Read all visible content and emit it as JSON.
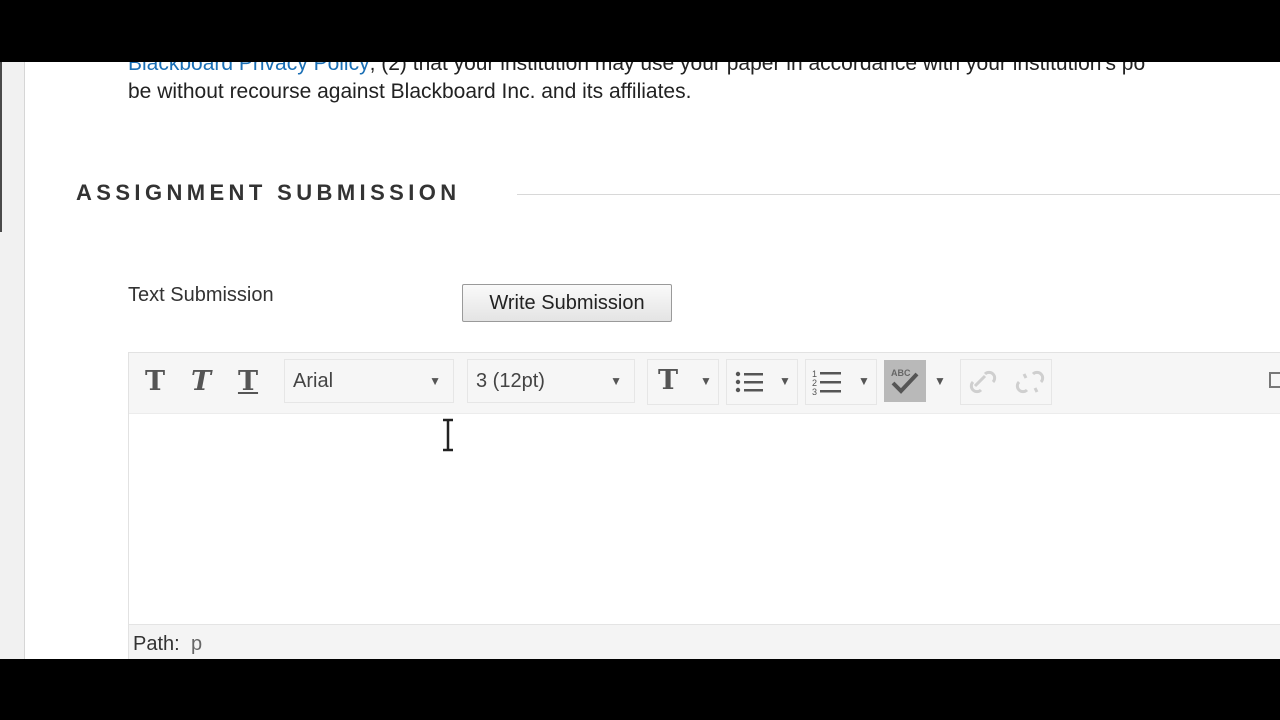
{
  "policy": {
    "line1_link": "Blackboard Privacy Policy",
    "line1_rest": "; (2) that your institution may use your paper in accordance with your institution's po",
    "line2": "be without recourse against Blackboard Inc. and its affiliates."
  },
  "section": {
    "title": "ASSIGNMENT SUBMISSION"
  },
  "text_submission": {
    "label": "Text Submission",
    "write_button": "Write Submission"
  },
  "editor": {
    "font_family": "Arial",
    "font_size": "3 (12pt)",
    "path_label": "Path:",
    "path_value": "p"
  },
  "colors": {
    "link": "#1a6fb5",
    "spellcheck_active": "#b9b9b9"
  }
}
